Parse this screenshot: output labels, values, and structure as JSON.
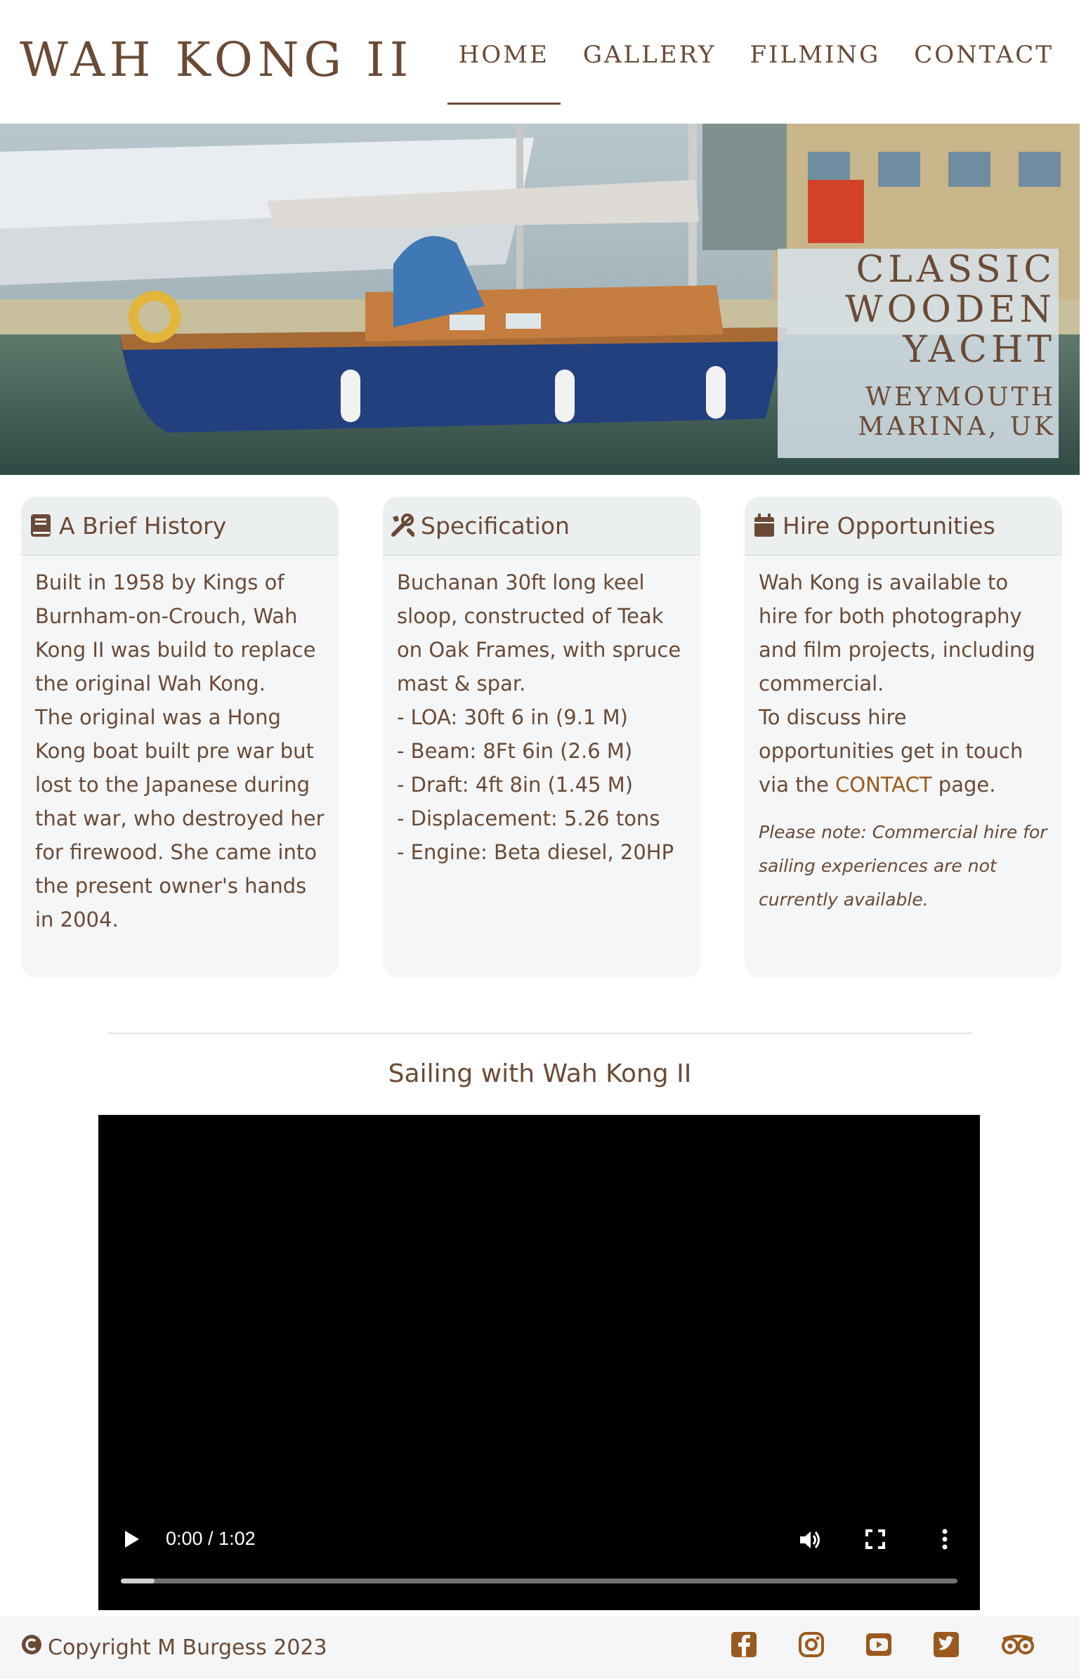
{
  "header": {
    "brand": "WAH KONG II",
    "nav": [
      {
        "label": "HOME",
        "active": true
      },
      {
        "label": "GALLERY",
        "active": false
      },
      {
        "label": "FILMING",
        "active": false
      },
      {
        "label": "CONTACT",
        "active": false
      }
    ]
  },
  "hero": {
    "title_lines": [
      "CLASSIC",
      "WOODEN",
      "YACHT"
    ],
    "subtitle_lines": [
      "WEYMOUTH",
      "MARINA, UK"
    ]
  },
  "cards": [
    {
      "icon": "book-icon",
      "title": "A Brief History",
      "paragraphs": [
        "Built in 1958 by Kings of Burnham-on-Crouch, Wah Kong II was build to replace the original Wah Kong.",
        "The original was a Hong Kong boat built pre war but lost to the Japanese during that war, who destroyed her for firewood. She came into the present owner's hands in 2004."
      ]
    },
    {
      "icon": "tools-icon",
      "title": "Specification",
      "intro": "Buchanan 30ft long keel sloop, constructed of Teak on Oak Frames, with spruce mast & spar.",
      "specs": [
        "- LOA: 30ft 6 in (9.1 M)",
        "- Beam: 8Ft 6in (2.6 M)",
        "- Draft: 4ft 8in (1.45 M)",
        "- Displacement: 5.26 tons",
        "- Engine: Beta diesel, 20HP"
      ]
    },
    {
      "icon": "calendar-icon",
      "title": "Hire Opportunities",
      "paragraph1": "Wah Kong is available to hire for both photography and film projects, including commercial.",
      "paragraph2_pre": "To discuss hire opportunities get in touch via the",
      "paragraph2_link": "CONTACT",
      "paragraph2_post": "page.",
      "note": "Please note: Commercial hire for sailing experiences are not currently available."
    }
  ],
  "video": {
    "title": "Sailing with Wah Kong II",
    "time": "0:00 / 1:02",
    "progress_fraction": 0.04
  },
  "footer": {
    "copyright": "Copyright M Burgess 2023",
    "social": [
      "facebook-icon",
      "instagram-icon",
      "youtube-icon",
      "twitter-icon",
      "tripadvisor-icon"
    ]
  },
  "colors": {
    "text": "#6b4a35",
    "link": "#9b5a1d",
    "card_bg": "#f4f6f7",
    "hull": "#23407e"
  }
}
